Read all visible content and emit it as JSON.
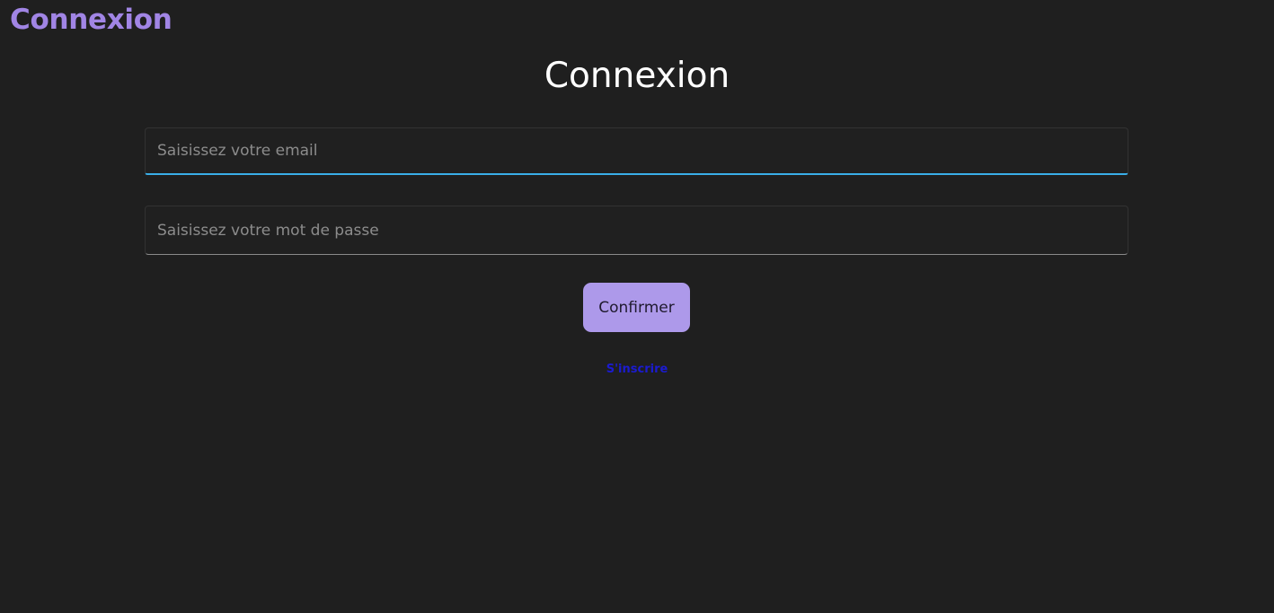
{
  "header": {
    "app_title": "Connexion"
  },
  "main": {
    "heading": "Connexion",
    "email_field": {
      "placeholder": "Saisissez votre email",
      "value": ""
    },
    "password_field": {
      "placeholder": "Saisissez votre mot de passe",
      "value": ""
    },
    "confirm_label": "Confirmer",
    "signup_link": "S'inscrire"
  },
  "colors": {
    "background": "#1f1f1f",
    "accent": "#a185e5",
    "button": "#ad99ea",
    "focus_border": "#3aaee8",
    "link": "#1b1bd0"
  }
}
